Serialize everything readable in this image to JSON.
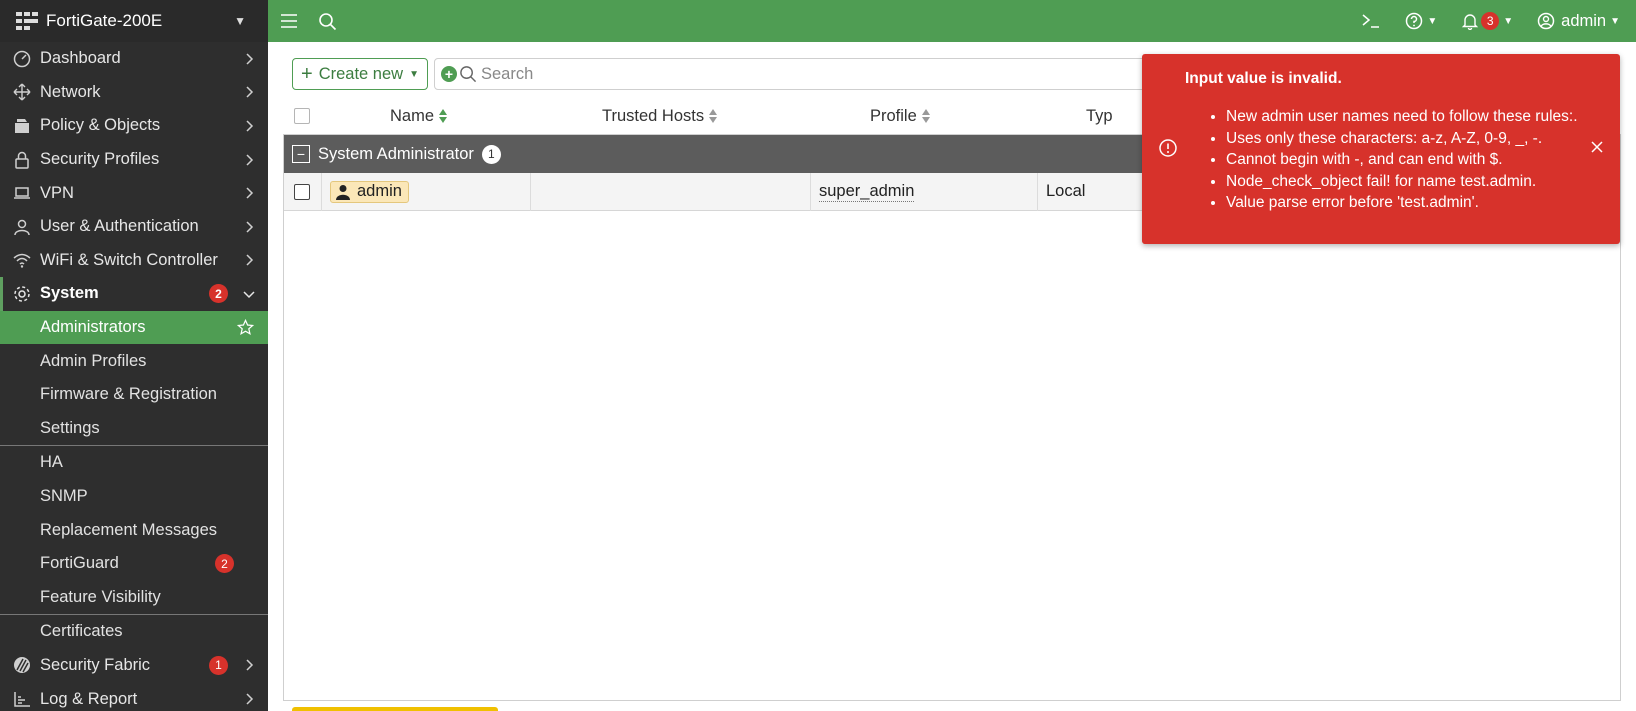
{
  "brand": {
    "name": "FortiGate-200E"
  },
  "sidebar": {
    "items": [
      {
        "label": "Dashboard",
        "icon": "dashboard-icon"
      },
      {
        "label": "Network",
        "icon": "network-icon"
      },
      {
        "label": "Policy & Objects",
        "icon": "policy-icon"
      },
      {
        "label": "Security Profiles",
        "icon": "lock-icon"
      },
      {
        "label": "VPN",
        "icon": "laptop-icon"
      },
      {
        "label": "User & Authentication",
        "icon": "user-icon"
      },
      {
        "label": "WiFi & Switch Controller",
        "icon": "wifi-icon"
      }
    ],
    "system": {
      "label": "System",
      "badge": "2"
    },
    "system_sub": [
      {
        "label": "Administrators"
      },
      {
        "label": "Admin Profiles"
      },
      {
        "label": "Firmware & Registration"
      },
      {
        "label": "Settings"
      }
    ],
    "system_sub2": [
      {
        "label": "HA"
      },
      {
        "label": "SNMP"
      },
      {
        "label": "Replacement Messages"
      },
      {
        "label": "FortiGuard",
        "badge": "2"
      },
      {
        "label": "Feature Visibility"
      }
    ],
    "system_sub3": [
      {
        "label": "Certificates"
      }
    ],
    "bottom": [
      {
        "label": "Security Fabric",
        "badge": "1"
      },
      {
        "label": "Log & Report"
      }
    ]
  },
  "topbar": {
    "notifications_count": "3",
    "user": "admin"
  },
  "toolbar": {
    "create_label": "Create new",
    "search_placeholder": "Search"
  },
  "table": {
    "headers": {
      "name": "Name",
      "trusted_hosts": "Trusted Hosts",
      "profile": "Profile",
      "type": "Typ"
    },
    "group": {
      "label": "System Administrator",
      "count": "1"
    },
    "rows": [
      {
        "name": "admin",
        "trusted_hosts": "",
        "profile": "super_admin",
        "type": "Local"
      }
    ]
  },
  "toast": {
    "title": "Input value is invalid.",
    "messages": [
      "New admin user names need to follow these rules:.",
      "Uses only these characters: a-z, A-Z, 0-9, _, -.",
      "Cannot begin with -, and can end with $.",
      "Node_check_object fail! for name test.admin.",
      "Value parse error before 'test.admin'."
    ]
  }
}
